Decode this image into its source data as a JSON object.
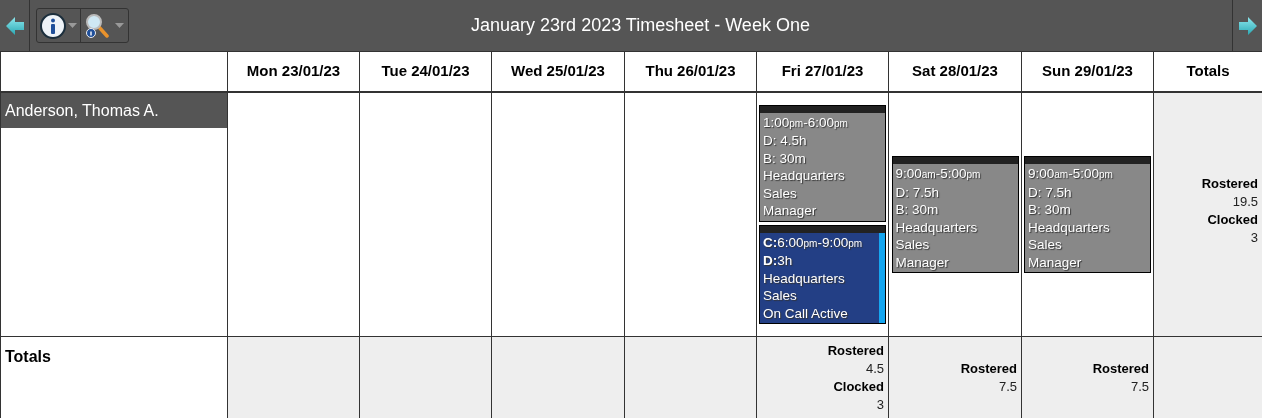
{
  "title": "January 23rd 2023 Timesheet - Week One",
  "employee": {
    "name": "Anderson, Thomas A."
  },
  "days": [
    {
      "label": "Mon 23/01/23"
    },
    {
      "label": "Tue 24/01/23"
    },
    {
      "label": "Wed 25/01/23"
    },
    {
      "label": "Thu 26/01/23"
    },
    {
      "label": "Fri 27/01/23",
      "shifts": [
        {
          "kind": "rostered",
          "start": "1:00",
          "start_period": "pm",
          "separator": "-",
          "end": "6:00",
          "end_period": "pm",
          "lines": [
            "D: 4.5h",
            "B: 30m",
            "Headquarters",
            "Sales",
            "Manager"
          ]
        },
        {
          "kind": "oncall",
          "prefix": "C:",
          "start": "6:00",
          "start_period": "pm",
          "separator": "-",
          "end": "9:00",
          "end_period": "pm",
          "lines": [
            "**D:**3h",
            "Headquarters",
            "Sales",
            "On Call Active"
          ]
        }
      ],
      "totals": [
        {
          "label": "Rostered",
          "value": "4.5"
        },
        {
          "label": "Clocked",
          "value": "3"
        }
      ]
    },
    {
      "label": "Sat 28/01/23",
      "shifts": [
        {
          "kind": "rostered",
          "start": "9:00",
          "start_period": "am",
          "separator": "-",
          "end": "5:00",
          "end_period": "pm",
          "lines": [
            "D: 7.5h",
            "B: 30m",
            "Headquarters",
            "Sales",
            "Manager"
          ]
        }
      ],
      "totals": [
        {
          "label": "Rostered",
          "value": "7.5"
        }
      ]
    },
    {
      "label": "Sun 29/01/23",
      "shifts": [
        {
          "kind": "rostered",
          "start": "9:00",
          "start_period": "am",
          "separator": "-",
          "end": "5:00",
          "end_period": "pm",
          "lines": [
            "D: 7.5h",
            "B: 30m",
            "Headquarters",
            "Sales",
            "Manager"
          ]
        }
      ],
      "totals": [
        {
          "label": "Rostered",
          "value": "7.5"
        }
      ]
    }
  ],
  "totals_column": {
    "label": "Totals",
    "employee_totals": [
      {
        "label": "Rostered",
        "value": "19.5"
      },
      {
        "label": "Clocked",
        "value": "3"
      }
    ]
  },
  "totals_row": {
    "label": "Totals"
  }
}
